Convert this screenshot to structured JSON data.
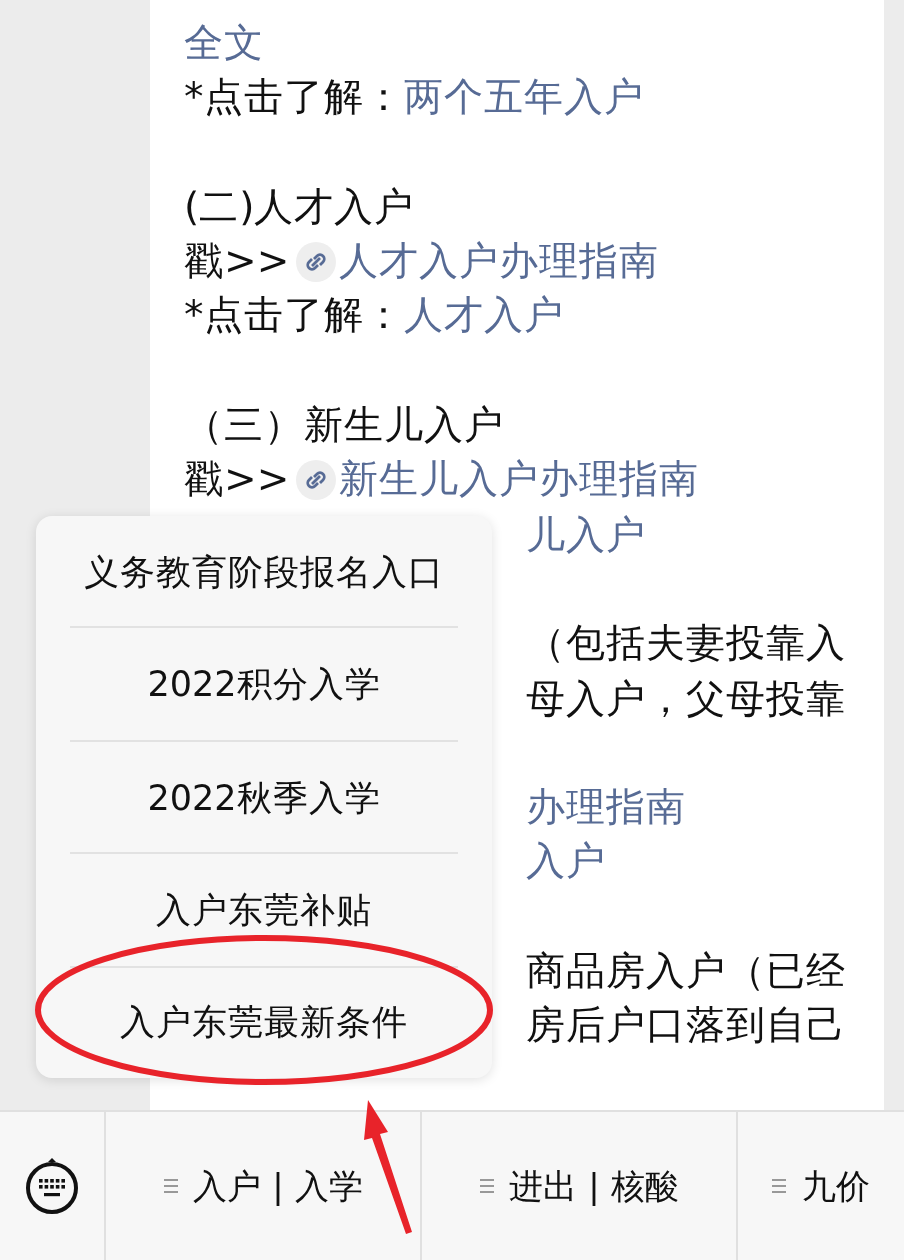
{
  "article": {
    "lines": [
      {
        "kind": "text",
        "segments": [
          {
            "text": "全文",
            "link": true
          }
        ]
      },
      {
        "kind": "text",
        "segments": [
          {
            "text": "*点击了解：",
            "link": false
          },
          {
            "text": "两个五年入户",
            "link": true
          }
        ]
      },
      {
        "kind": "gap"
      },
      {
        "kind": "text",
        "segments": [
          {
            "text": "(二)人才入户",
            "link": false
          }
        ]
      },
      {
        "kind": "text",
        "segments": [
          {
            "text": "戳>>",
            "link": false
          },
          {
            "text": "人才入户办理指南",
            "link": true,
            "icon": true
          }
        ]
      },
      {
        "kind": "text",
        "segments": [
          {
            "text": "*点击了解：",
            "link": false
          },
          {
            "text": "人才入户",
            "link": true
          }
        ]
      },
      {
        "kind": "gap"
      },
      {
        "kind": "text",
        "segments": [
          {
            "text": "（三）新生儿入户",
            "link": false
          }
        ]
      },
      {
        "kind": "text",
        "segments": [
          {
            "text": "戳>>",
            "link": false
          },
          {
            "text": "新生儿入户办理指南",
            "link": true,
            "icon": true
          }
        ]
      },
      {
        "kind": "tail",
        "segments": [
          {
            "text": "儿入户",
            "link": true
          }
        ]
      },
      {
        "kind": "gap"
      },
      {
        "kind": "tail",
        "segments": [
          {
            "text": "（包括夫妻投靠入",
            "link": false
          }
        ]
      },
      {
        "kind": "tail",
        "segments": [
          {
            "text": "母入户，父母投靠",
            "link": false
          }
        ]
      },
      {
        "kind": "gap"
      },
      {
        "kind": "tail",
        "segments": [
          {
            "text": "办理指南",
            "link": true
          }
        ]
      },
      {
        "kind": "tail",
        "segments": [
          {
            "text": "入户",
            "link": true
          }
        ]
      },
      {
        "kind": "gap"
      },
      {
        "kind": "tail",
        "segments": [
          {
            "text": "商品房入户（已经",
            "link": false
          }
        ]
      },
      {
        "kind": "tail",
        "segments": [
          {
            "text": "房后户口落到自己",
            "link": false
          }
        ]
      }
    ]
  },
  "popup_menu": {
    "items": [
      {
        "label": "义务教育阶段报名入口",
        "circled": false
      },
      {
        "label": "2022积分入学",
        "circled": false
      },
      {
        "label": "2022秋季入学",
        "circled": false
      },
      {
        "label": "入户东莞补贴",
        "circled": false
      },
      {
        "label": "入户东莞最新条件",
        "circled": true
      }
    ]
  },
  "bottom_menu": {
    "tabs": [
      {
        "label": "入户 | 入学"
      },
      {
        "label": "进出 | 核酸"
      },
      {
        "label": "九价"
      }
    ]
  }
}
